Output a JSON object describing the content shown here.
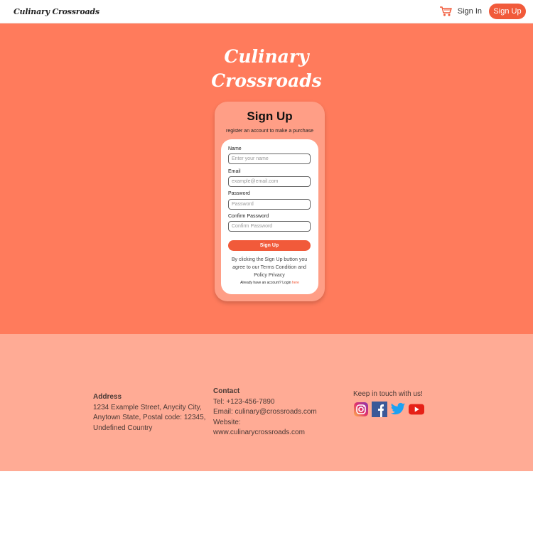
{
  "header": {
    "brand": "Culinary Crossroads",
    "sign_in": "Sign In",
    "sign_up": "Sign Up",
    "cart_icon": "cart-icon"
  },
  "hero": {
    "logo_line1": "Culinary",
    "logo_line2": "Crossroads"
  },
  "card": {
    "title": "Sign Up",
    "subtitle": "register an account to make a purchase",
    "fields": [
      {
        "label": "Name",
        "placeholder": "Enter your name"
      },
      {
        "label": "Email",
        "placeholder": "example@email.com"
      },
      {
        "label": "Password",
        "placeholder": "Password"
      },
      {
        "label": "Confirm Password",
        "placeholder": "Confirm Password"
      }
    ],
    "submit": "Sign Up",
    "terms": "By clicking the Sign Up button you agree to our Terms Condition and Policy Privacy",
    "already_text": "Already have an account? Login",
    "login_link": "here"
  },
  "footer": {
    "address_heading": "Address",
    "address_text": "1234 Example Street, Anycity City, Anytown State, Postal code: 12345, Undefined Country",
    "contact_heading": "Contact",
    "tel": "Tel: +123-456-7890",
    "email": "Email: culinary@crossroads.com",
    "website_label": "Website:",
    "website": "www.culinarycrossroads.com",
    "social_heading": "Keep in touch with us!",
    "social_icons": [
      "instagram-icon",
      "facebook-icon",
      "twitter-icon",
      "youtube-icon"
    ]
  },
  "colors": {
    "accent": "#f15a3a",
    "hero_bg": "#ff7b5c",
    "card_bg": "#ff9e86",
    "footer_bg": "#ffab95"
  }
}
